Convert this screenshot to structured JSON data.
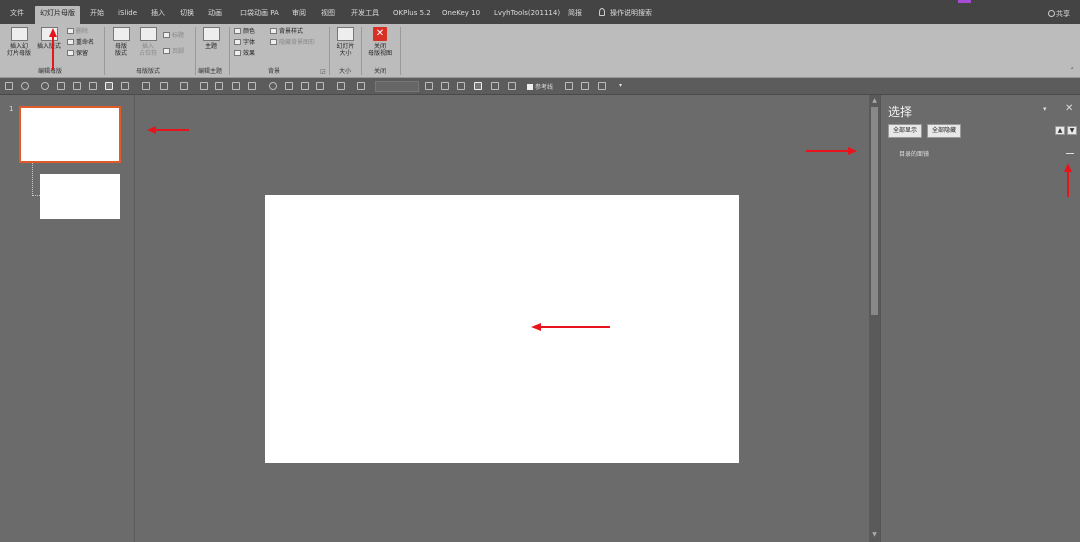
{
  "tabs": [
    "文件",
    "幻灯片母版",
    "开始",
    "iSlide",
    "插入",
    "切换",
    "动画",
    "口袋动画 PA",
    "审阅",
    "视图",
    "开发工具",
    "OKPlus 5.2",
    "OneKey 10",
    "LvyhTools(201114)",
    "简报",
    "操作说明搜索"
  ],
  "share_label": "共享",
  "ribbon": {
    "edit_master": {
      "insert_master": "插入幻\n灯片母版",
      "insert_layout": "插入版式",
      "delete": "删除",
      "rename": "重命名",
      "preserve": "保留",
      "label": "编辑母版"
    },
    "master_layout": {
      "master_layout_btn": "母版\n版式",
      "insert_placeholder": "插入\n占位符",
      "title": "标题",
      "footer": "页脚",
      "label": "母版版式"
    },
    "edit_theme": {
      "theme": "主题",
      "label": "编辑主题"
    },
    "background": {
      "colors": "颜色",
      "fonts": "字体",
      "effects": "效果",
      "bg_styles": "背景样式",
      "hide_bg": "隐藏背景图形",
      "label": "背景"
    },
    "size": {
      "slide_size": "幻灯片\n大小",
      "label": "大小"
    },
    "close": {
      "close_master": "关闭\n母版视图",
      "label": "关闭"
    }
  },
  "qat": {
    "guides_label": "参考线"
  },
  "thumbnails": {
    "slide_number": "1"
  },
  "selection_pane": {
    "title": "选择",
    "show_all": "全部显示",
    "hide_all": "全部隐藏",
    "item_label": "目录的面镜"
  },
  "colors": {
    "accent_orange": "#e05a2a",
    "annotation_red": "#e8141c",
    "close_red": "#d93025"
  }
}
